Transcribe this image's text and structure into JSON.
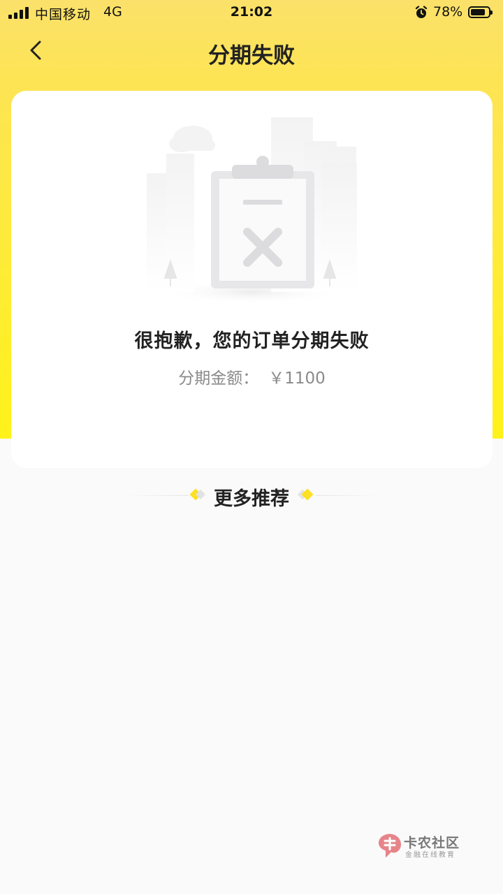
{
  "status_bar": {
    "carrier": "中国移动",
    "network": "4G",
    "time": "21:02",
    "battery": "78%",
    "icons": [
      "signal-icon",
      "alarm-icon",
      "battery-icon"
    ]
  },
  "nav": {
    "title": "分期失败",
    "back_icon": "chevron-left-icon"
  },
  "result": {
    "illustration": "failed-order-clipboard-icon",
    "message": "很抱歉，您的订单分期失败",
    "amount_label": "分期金额：",
    "amount_value": "￥1100"
  },
  "recommend": {
    "title": "更多推荐"
  },
  "watermark": {
    "title": "卡农社区",
    "subtitle": "金融在线教育"
  },
  "colors": {
    "header_yellow": "#fde455",
    "accent_yellow": "#fde021",
    "page_bg": "#fafafa",
    "card_bg": "#ffffff",
    "text_dark": "#222222",
    "text_gray": "#8a8a8a"
  }
}
